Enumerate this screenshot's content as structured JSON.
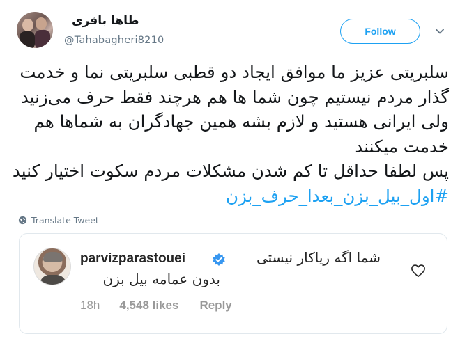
{
  "tweet": {
    "display_name": "طاها باقری",
    "screen_name": "@Tahabagheri8210",
    "follow_label": "Follow",
    "text_lines": [
      "سلبریتی عزیز ما موافق ایجاد دو قطبی سلبریتی نما و خدمت",
      "گذار مردم نیستیم چون شما ها هم هرچند فقط حرف می‌زنید",
      "ولی ایرانی هستید و لازم بشه همین جهادگران به شماها هم",
      "خدمت میکنند",
      "پس لطفا حداقل تا کم شدن مشکلات مردم سکوت اختیار کنید"
    ],
    "hashtag": "#اول_بیل_بزن_بعدا_حرف_بزن",
    "translate_label": "Translate Tweet"
  },
  "embedded_comment": {
    "username": "parvizparastouei",
    "text_line_1": "شما اگه ریاکار نیستی",
    "text_line_2": "بدون عمامه بیل بزن",
    "time": "18h",
    "likes": "4,548 likes",
    "reply_label": "Reply"
  },
  "colors": {
    "accent": "#1da1f2",
    "text": "#14171a",
    "muted": "#657786",
    "verified": "#3897f0"
  },
  "icons": {
    "menu": "chevron-down-icon",
    "translate": "globe-icon",
    "verified": "verified-icon",
    "like": "heart-icon"
  }
}
